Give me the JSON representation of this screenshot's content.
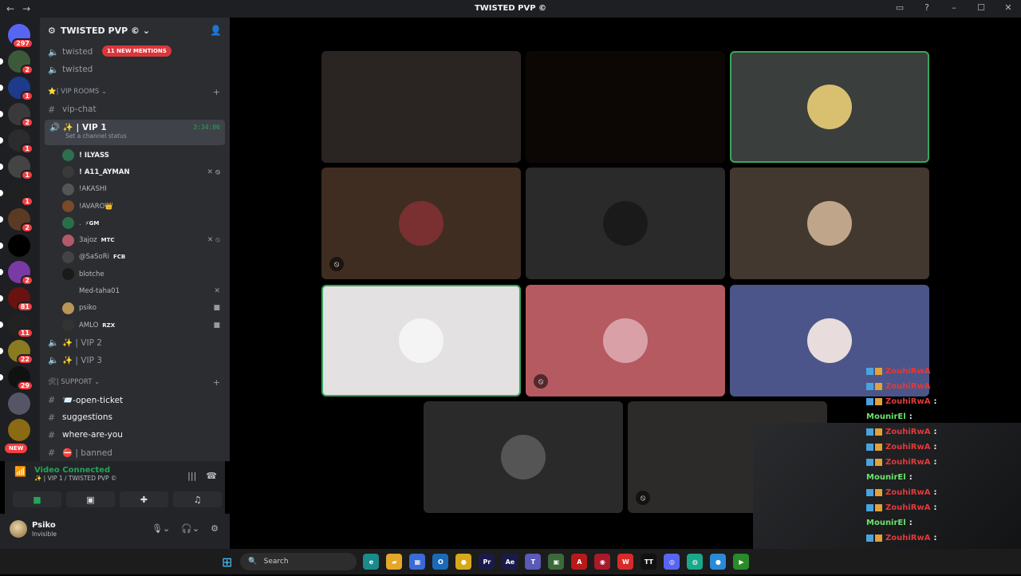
{
  "window": {
    "title": "TWISTED PVP ©",
    "nav": [
      "←",
      "→"
    ],
    "right_icons": [
      "inbox-icon",
      "help-icon",
      "minimize-icon",
      "maximize-icon",
      "close-icon"
    ]
  },
  "servers": {
    "items": [
      {
        "name": "dm",
        "badge": "297",
        "color": "#5865f2"
      },
      {
        "name": "s1",
        "badge": "2",
        "color": "#3c5a3a"
      },
      {
        "name": "s2",
        "badge": "1",
        "color": "#1d3b8a"
      },
      {
        "name": "s3",
        "badge": "2",
        "color": "#3a3a3a"
      },
      {
        "name": "s4",
        "badge": "1",
        "color": "#2c2c2c"
      },
      {
        "name": "s5",
        "badge": "1",
        "color": "#444"
      },
      {
        "name": "s6",
        "badge": "1",
        "color": "#202020"
      },
      {
        "name": "s7",
        "badge": "2",
        "color": "#5b3a24"
      },
      {
        "name": "s8",
        "badge": "",
        "color": "#000"
      },
      {
        "name": "s9",
        "badge": "2",
        "color": "#7a3aa6"
      },
      {
        "name": "s10",
        "badge": "81",
        "color": "#6a1111"
      },
      {
        "name": "s11",
        "badge": "11",
        "color": "#222"
      },
      {
        "name": "s12",
        "badge": "22",
        "color": "#8a7a20"
      },
      {
        "name": "s13",
        "badge": "29",
        "color": "#111"
      },
      {
        "name": "s14",
        "badge": "",
        "color": "#556"
      },
      {
        "name": "s15",
        "badge": "",
        "color": "#8a6a12"
      }
    ],
    "new_label": "NEW"
  },
  "guild": {
    "name": "TWISTED PVP ©"
  },
  "channels": {
    "top": [
      {
        "label": "twisted",
        "mention": "11 NEW MENTIONS"
      },
      {
        "label": "twisted"
      }
    ],
    "vip_category": "⭐| VIP ROOMS",
    "vip_chat": "vip-chat",
    "vip1": {
      "label": "✨ | VIP 1",
      "time": "3:34:06",
      "status": "Set a channel status"
    },
    "members": [
      {
        "name": "! ILYASS",
        "bold": true,
        "tag": "",
        "icons": "",
        "color": "#2f6e4f"
      },
      {
        "name": "! A11_AYMAN",
        "bold": true,
        "tag": "",
        "icons": "✕ ⦸",
        "color": "#3a3a3a"
      },
      {
        "name": "!AKASHI",
        "bold": false,
        "tag": "",
        "icons": "",
        "color": "#555"
      },
      {
        "name": "!AVARO👑",
        "bold": false,
        "tag": "",
        "icons": "",
        "color": "#7a4a2a"
      },
      {
        "name": ".",
        "bold": false,
        "tag": "⚡GM",
        "icons": "",
        "color": "#2a6e4a"
      },
      {
        "name": "3ajoz",
        "bold": false,
        "tag": "MTC",
        "icons": "✕ ⦸",
        "color": "#b05a6a"
      },
      {
        "name": "@SaSoRi",
        "bold": false,
        "tag": "FCB",
        "icons": "",
        "color": "#444"
      },
      {
        "name": "blotche",
        "bold": false,
        "tag": "",
        "icons": "",
        "color": "#1a1a1a"
      },
      {
        "name": "Med-taha01",
        "bold": false,
        "tag": "",
        "icons": "✕",
        "color": "#2b2d31"
      },
      {
        "name": "psiko",
        "bold": false,
        "tag": "",
        "icons": "■",
        "color": "#b9955a"
      },
      {
        "name": "AMLO",
        "bold": false,
        "tag": "RZX",
        "icons": "■",
        "color": "#333"
      }
    ],
    "vip2": "✨ | VIP 2",
    "vip3": "✨ | VIP 3",
    "support_category": "🛠| SUPPORT",
    "support": [
      {
        "label": "📨-open-ticket"
      },
      {
        "label": "suggestions"
      },
      {
        "label": "where-are-you"
      },
      {
        "label": "⛔ | banned"
      }
    ]
  },
  "voice": {
    "status": "Video Connected",
    "channel": "✨ | VIP 1 / TWISTED PVP ©",
    "buttons": [
      "camera-icon",
      "screen-share-icon",
      "activity-icon",
      "soundboard-icon"
    ]
  },
  "user": {
    "name": "Psiko",
    "status": "Invisible"
  },
  "tiles": [
    {
      "bg": "#2a2522",
      "avatar": "",
      "mute": false,
      "speaking": false
    },
    {
      "bg": "#0c0705",
      "avatar": "",
      "mute": false,
      "speaking": false
    },
    {
      "bg": "#3a3e3d",
      "avatar": "#d9c070",
      "mute": false,
      "speaking": true
    },
    {
      "bg": "#3f2d22",
      "avatar": "#7a3030",
      "mute": true,
      "speaking": false
    },
    {
      "bg": "#2a2a2a",
      "avatar": "#1a1a1a",
      "mute": false,
      "speaking": false
    },
    {
      "bg": "#43382f",
      "avatar": "#bfa68a",
      "mute": false,
      "speaking": false
    },
    {
      "bg": "#e3e1e1",
      "avatar": "#f4f4f4",
      "mute": false,
      "speaking": true
    },
    {
      "bg": "#b55a60",
      "avatar": "#d9a0a8",
      "mute": true,
      "speaking": false
    },
    {
      "bg": "#4b5589",
      "avatar": "#e8dcdc",
      "mute": false,
      "speaking": false
    },
    {
      "bg": "#2a2a2a",
      "avatar": "#555",
      "mute": false,
      "speaking": false
    },
    {
      "bg": "#2c2b29",
      "avatar": "",
      "mute": true,
      "speaking": false
    }
  ],
  "chat": [
    {
      "name": "ZouhiRwA",
      "sep": "",
      "type": "red"
    },
    {
      "name": "ZouhiRwA",
      "sep": "",
      "type": "red"
    },
    {
      "name": "ZouhiRwA",
      "sep": ":",
      "type": "red"
    },
    {
      "name": "MounirEl",
      "sep": ":",
      "type": "green"
    },
    {
      "name": "ZouhiRwA",
      "sep": ":",
      "type": "red"
    },
    {
      "name": "ZouhiRwA",
      "sep": ":",
      "type": "red"
    },
    {
      "name": "ZouhiRwA",
      "sep": ":",
      "type": "red"
    },
    {
      "name": "MounirEl",
      "sep": ":",
      "type": "green"
    },
    {
      "name": "ZouhiRwA",
      "sep": ":",
      "type": "red"
    },
    {
      "name": "ZouhiRwA",
      "sep": ":",
      "type": "red"
    },
    {
      "name": "MounirEl",
      "sep": ":",
      "type": "green"
    },
    {
      "name": "ZouhiRwA",
      "sep": ":",
      "type": "red"
    },
    {
      "name": "ZouhiRwA",
      "sep": ":",
      "type": "red"
    },
    {
      "name": "MounirEl",
      "sep": ":",
      "type": "green"
    }
  ],
  "taskbar": {
    "search": "Search",
    "apps": [
      {
        "name": "edge-icon",
        "color": "#1a8a8a",
        "glyph": "e"
      },
      {
        "name": "explorer-icon",
        "color": "#e3a82a",
        "glyph": "▰"
      },
      {
        "name": "store-icon",
        "color": "#3a6ad6",
        "glyph": "▦"
      },
      {
        "name": "outlook-icon",
        "color": "#1a6ab8",
        "glyph": "O"
      },
      {
        "name": "chrome-icon",
        "color": "#d8a81a",
        "glyph": "●"
      },
      {
        "name": "premiere-icon",
        "color": "#1a1a4a",
        "glyph": "Pr"
      },
      {
        "name": "aftereffects-icon",
        "color": "#1a1a4a",
        "glyph": "Ae"
      },
      {
        "name": "teams-icon",
        "color": "#5a5ab8",
        "glyph": "T"
      },
      {
        "name": "minecraft-icon",
        "color": "#3a6a3a",
        "glyph": "▣"
      },
      {
        "name": "acrobat-icon",
        "color": "#b81a1a",
        "glyph": "A"
      },
      {
        "name": "valorant-icon",
        "color": "#a81a2a",
        "glyph": "◉"
      },
      {
        "name": "wps-icon",
        "color": "#d82a2a",
        "glyph": "W"
      },
      {
        "name": "tiktok-icon",
        "color": "#111",
        "glyph": "TT"
      },
      {
        "name": "discord-icon",
        "color": "#5865f2",
        "glyph": "◎"
      },
      {
        "name": "app-icon",
        "color": "#1aa88a",
        "glyph": "◍"
      },
      {
        "name": "chrome-dev-icon",
        "color": "#2a8ad8",
        "glyph": "●"
      },
      {
        "name": "play-icon",
        "color": "#2a8a2a",
        "glyph": "▶"
      }
    ]
  }
}
